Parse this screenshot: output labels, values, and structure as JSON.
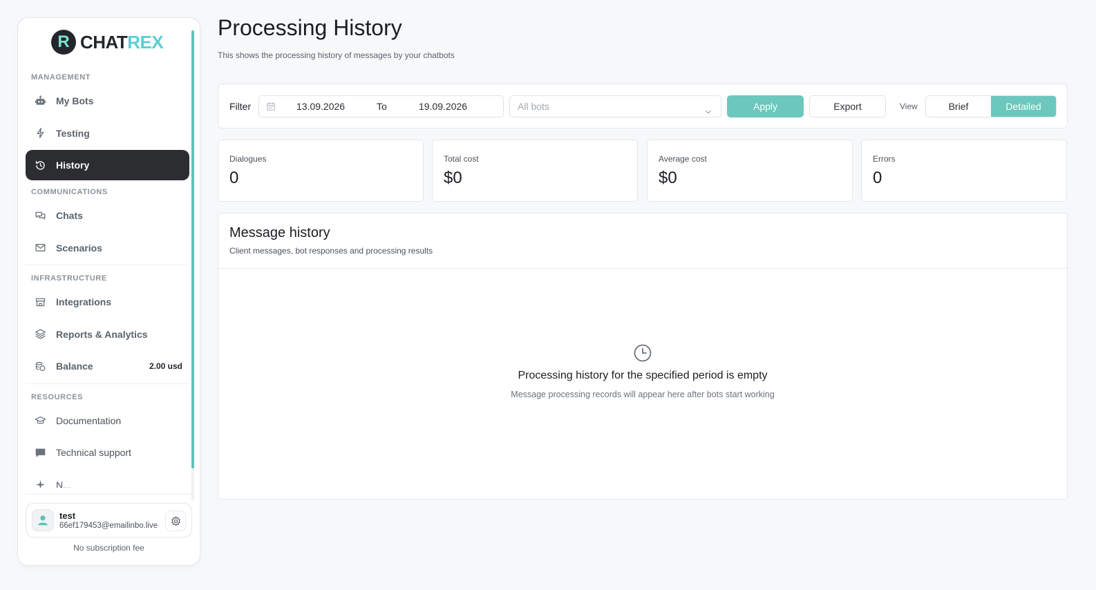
{
  "brand": {
    "mark": "R",
    "name_part1": "CHAT",
    "name_part2": "REX",
    "mark_color": "#7fe0cf",
    "accent_color": "#5ccfd4"
  },
  "sidebar": {
    "sections": {
      "management": "MANAGEMENT",
      "communications": "COMMUNICATIONS",
      "infrastructure": "INFRASTRUCTURE",
      "resources": "RESOURCES"
    },
    "items": {
      "my_bots": {
        "label": "My Bots",
        "icon": "robot-icon"
      },
      "testing": {
        "label": "Testing",
        "icon": "lightning-icon"
      },
      "history": {
        "label": "History",
        "icon": "history-icon",
        "active": true
      },
      "chats": {
        "label": "Chats",
        "icon": "chats-icon"
      },
      "scenarios": {
        "label": "Scenarios",
        "icon": "mail-icon"
      },
      "integrations": {
        "label": "Integrations",
        "icon": "store-icon"
      },
      "reports": {
        "label": "Reports & Analytics",
        "icon": "layers-icon"
      },
      "balance": {
        "label": "Balance",
        "icon": "coins-icon",
        "value": "2.00 usd"
      },
      "documentation": {
        "label": "Documentation",
        "icon": "graduation-cap-icon"
      },
      "support": {
        "label": "Technical support",
        "icon": "chat-bubble-icon"
      },
      "partial": {
        "label": "N..."
      }
    },
    "user": {
      "name": "test",
      "email": "66ef179453@emailinbo.live"
    },
    "subscription_note": "No subscription fee"
  },
  "page": {
    "title": "Processing History",
    "subtitle": "This shows the processing history of messages by your chatbots"
  },
  "filter": {
    "label": "Filter",
    "date_from": "13.09.2026",
    "to_label": "To",
    "date_to": "19.09.2026",
    "bots_placeholder": "All bots",
    "apply_label": "Apply",
    "export_label": "Export",
    "view_label": "View",
    "view_options": [
      "Brief",
      "Detailed"
    ],
    "view_selected": "Detailed",
    "accent_color": "#6cc7bd"
  },
  "stats": [
    {
      "label": "Dialogues",
      "value": "0"
    },
    {
      "label": "Total cost",
      "value": "$0"
    },
    {
      "label": "Average cost",
      "value": "$0"
    },
    {
      "label": "Errors",
      "value": "0"
    }
  ],
  "history": {
    "title": "Message history",
    "subtitle": "Client messages, bot responses and processing results",
    "empty_title": "Processing history for the specified period is empty",
    "empty_subtitle": "Message processing records will appear here after bots start working",
    "empty_icon": "clock-icon"
  }
}
